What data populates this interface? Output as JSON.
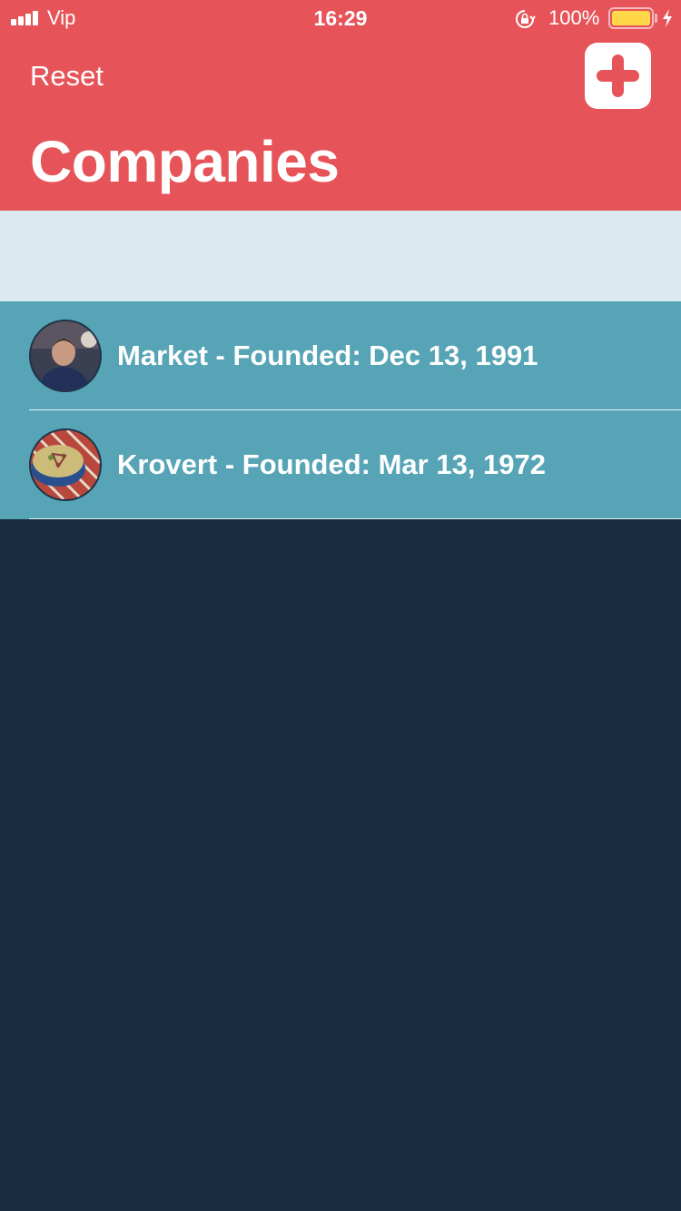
{
  "status_bar": {
    "carrier": "Vip",
    "time": "16:29",
    "battery_percent": "100%",
    "battery_level": 1.0,
    "icons": [
      "signal-icon",
      "orientation-lock-icon",
      "battery-icon",
      "charging-bolt-icon"
    ]
  },
  "nav": {
    "left_button": "Reset",
    "right_button_icon": "plus-icon",
    "title": "Companies"
  },
  "companies": [
    {
      "label": "Market - Founded: Dec 13, 1991",
      "avatar": "person-photo"
    },
    {
      "label": "Krovert - Founded: Mar 13, 1972",
      "avatar": "food-photo"
    }
  ],
  "colors": {
    "header": "#e65459",
    "section_header": "#dce9f1",
    "row": "#56a4b6",
    "background": "#172c40",
    "battery": "#ffd84a"
  }
}
